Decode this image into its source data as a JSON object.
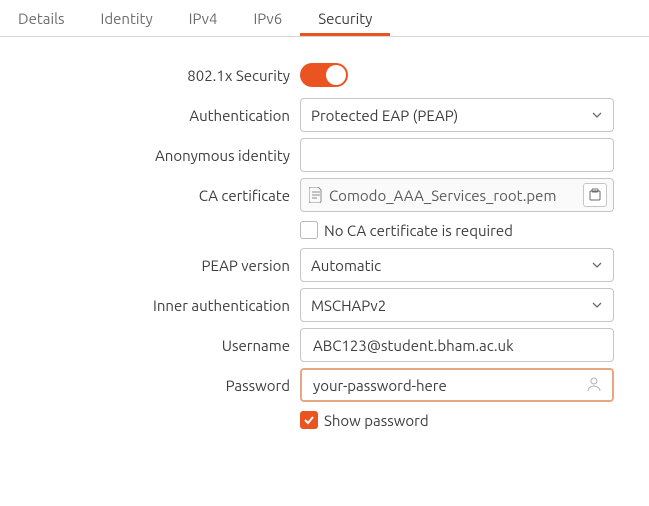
{
  "tabs": {
    "details": "Details",
    "identity": "Identity",
    "ipv4": "IPv4",
    "ipv6": "IPv6",
    "security": "Security"
  },
  "labels": {
    "sec8021x": "802.1x Security",
    "authentication": "Authentication",
    "anon_identity": "Anonymous identity",
    "ca_cert": "CA certificate",
    "no_ca_req": "No CA certificate is required",
    "peap_version": "PEAP version",
    "inner_auth": "Inner authentication",
    "username": "Username",
    "password": "Password",
    "show_password": "Show password"
  },
  "values": {
    "authentication": "Protected EAP (PEAP)",
    "anon_identity": "",
    "ca_cert_file": "Comodo_AAA_Services_root.pem",
    "no_ca_req_checked": false,
    "peap_version": "Automatic",
    "inner_auth": "MSCHAPv2",
    "username": "ABC123@student.bham.ac.uk",
    "password": "your-password-here",
    "show_password_checked": true,
    "sec8021x_enabled": true
  }
}
